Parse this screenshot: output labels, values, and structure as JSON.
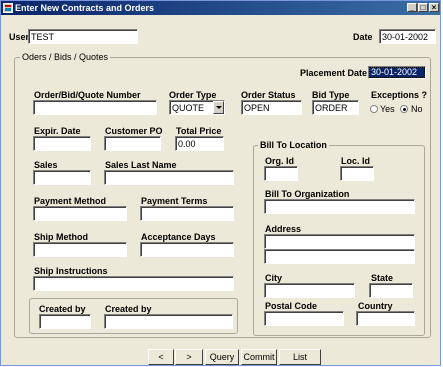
{
  "window": {
    "title": "Enter New Contracts and Orders",
    "minimize": "_",
    "maximize": "□",
    "close": "×"
  },
  "header": {
    "user_label": "User",
    "user_value": "TEST",
    "date_label": "Date",
    "date_value": "30-01-2002"
  },
  "group_orders": {
    "legend": "Oders / Bids / Quotes"
  },
  "placement": {
    "label": "Placement Date",
    "value": "30-01-2002"
  },
  "order": {
    "number_label": "Order/Bid/Quote Number",
    "number_value": "",
    "type_label": "Order Type",
    "type_value": "QUOTE",
    "status_label": "Order Status",
    "status_value": "OPEN",
    "bid_type_label": "Bid Type",
    "bid_type_value": "ORDER",
    "exceptions_label": "Exceptions ?",
    "exceptions_yes": "Yes",
    "exceptions_no": "No",
    "exceptions_selected": "No"
  },
  "fields": {
    "expir_label": "Expir. Date",
    "expir_value": "",
    "customer_po_label": "Customer PO",
    "customer_po_value": "",
    "total_price_label": "Total Price",
    "total_price_value": "0.00",
    "sales_label": "Sales",
    "sales_value": "",
    "sales_last_label": "Sales Last Name",
    "sales_last_value": "",
    "payment_method_label": "Payment Method",
    "payment_method_value": "",
    "payment_terms_label": "Payment Terms",
    "payment_terms_value": "",
    "ship_method_label": "Ship Method",
    "ship_method_value": "",
    "acceptance_days_label": "Acceptance Days",
    "acceptance_days_value": "",
    "ship_instructions_label": "Ship Instructions",
    "ship_instructions_value": "",
    "created_by_label": "Created by",
    "created_by_value": "",
    "created_by2_label": "Created by",
    "created_by2_value": ""
  },
  "bill_to": {
    "legend": "Bill To Location",
    "org_id_label": "Org. Id",
    "org_id_value": "",
    "loc_id_label": "Loc. Id",
    "loc_id_value": "",
    "organization_label": "Bill To Organization",
    "organization_value": "",
    "address_label": "Address",
    "address_line1": "",
    "address_line2": "",
    "city_label": "City",
    "city_value": "",
    "state_label": "State",
    "state_value": "",
    "postal_label": "Postal Code",
    "postal_value": "",
    "country_label": "Country",
    "country_value": ""
  },
  "buttons": {
    "prev": "<",
    "next": ">",
    "query": "Query",
    "commit": "Commit",
    "list": "List"
  }
}
